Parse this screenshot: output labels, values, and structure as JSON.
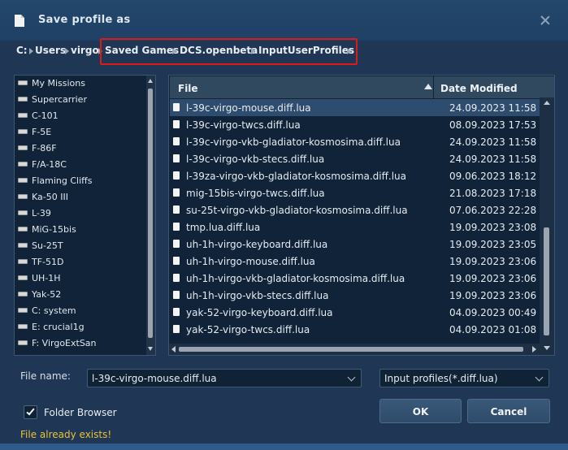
{
  "window": {
    "title": "Save profile as",
    "colors": {
      "title_bar": "#23466b",
      "panel_bg": "#102338",
      "selected_row": "#2e4d6e",
      "warning_text": "#e8c23a",
      "highlight_border": "#e01818"
    }
  },
  "breadcrumb": [
    {
      "label": "C:"
    },
    {
      "label": "Users"
    },
    {
      "label": "virgo"
    },
    {
      "label": "Saved Games"
    },
    {
      "label": "DCS.openbeta"
    },
    {
      "label": "InputUserProfiles"
    }
  ],
  "folder_tree": [
    {
      "label": "My Missions"
    },
    {
      "label": "Supercarrier"
    },
    {
      "label": "C-101"
    },
    {
      "label": "F-5E"
    },
    {
      "label": "F-86F"
    },
    {
      "label": "F/A-18C"
    },
    {
      "label": "Flaming Cliffs"
    },
    {
      "label": "Ka-50 III"
    },
    {
      "label": "L-39"
    },
    {
      "label": "MiG-15bis"
    },
    {
      "label": "Su-25T"
    },
    {
      "label": "TF-51D"
    },
    {
      "label": "UH-1H"
    },
    {
      "label": "Yak-52"
    },
    {
      "label": "C: system"
    },
    {
      "label": "E: crucial1g"
    },
    {
      "label": "F: VirgoExtSan"
    }
  ],
  "file_list": {
    "columns": {
      "file": "File",
      "date_modified": "Date Modified"
    },
    "sort": {
      "column": "File",
      "direction": "ascending"
    },
    "rows": [
      {
        "name": "l-39c-virgo-mouse.diff.lua",
        "date": "24.09.2023 11:58",
        "selected": true
      },
      {
        "name": "l-39c-virgo-twcs.diff.lua",
        "date": "08.09.2023 17:53"
      },
      {
        "name": "l-39c-virgo-vkb-gladiator-kosmosima.diff.lua",
        "date": "24.09.2023 11:58"
      },
      {
        "name": "l-39c-virgo-vkb-stecs.diff.lua",
        "date": "24.09.2023 11:58"
      },
      {
        "name": "l-39za-virgo-vkb-gladiator-kosmosima.diff.lua",
        "date": "09.06.2023 18:12"
      },
      {
        "name": "mig-15bis-virgo-twcs.diff.lua",
        "date": "21.08.2023 17:18"
      },
      {
        "name": "su-25t-virgo-vkb-gladiator-kosmosima.diff.lua",
        "date": "07.06.2023 22:28"
      },
      {
        "name": "tmp.lua.diff.lua",
        "date": "19.09.2023 23:08"
      },
      {
        "name": "uh-1h-virgo-keyboard.diff.lua",
        "date": "19.09.2023 23:05"
      },
      {
        "name": "uh-1h-virgo-mouse.diff.lua",
        "date": "19.09.2023 23:06"
      },
      {
        "name": "uh-1h-virgo-vkb-gladiator-kosmosima.diff.lua",
        "date": "19.09.2023 23:06"
      },
      {
        "name": "uh-1h-virgo-vkb-stecs.diff.lua",
        "date": "19.09.2023 23:06"
      },
      {
        "name": "yak-52-virgo-keyboard.diff.lua",
        "date": "04.09.2023 00:49"
      },
      {
        "name": "yak-52-virgo-twcs.diff.lua",
        "date": "04.09.2023 01:08"
      }
    ]
  },
  "form": {
    "file_name_label": "File name:",
    "file_name_value": "l-39c-virgo-mouse.diff.lua",
    "file_type_value": "Input profiles(*.diff.lua)",
    "folder_browser_label": "Folder Browser",
    "folder_browser_checked": true
  },
  "buttons": {
    "ok": "OK",
    "cancel": "Cancel"
  },
  "status": {
    "warning": "File already exists!"
  },
  "icons": [
    "document-icon",
    "close-icon",
    "drive-icon",
    "file-icon",
    "sort-ascending-icon",
    "chevron-down-icon",
    "checkmark-icon"
  ]
}
